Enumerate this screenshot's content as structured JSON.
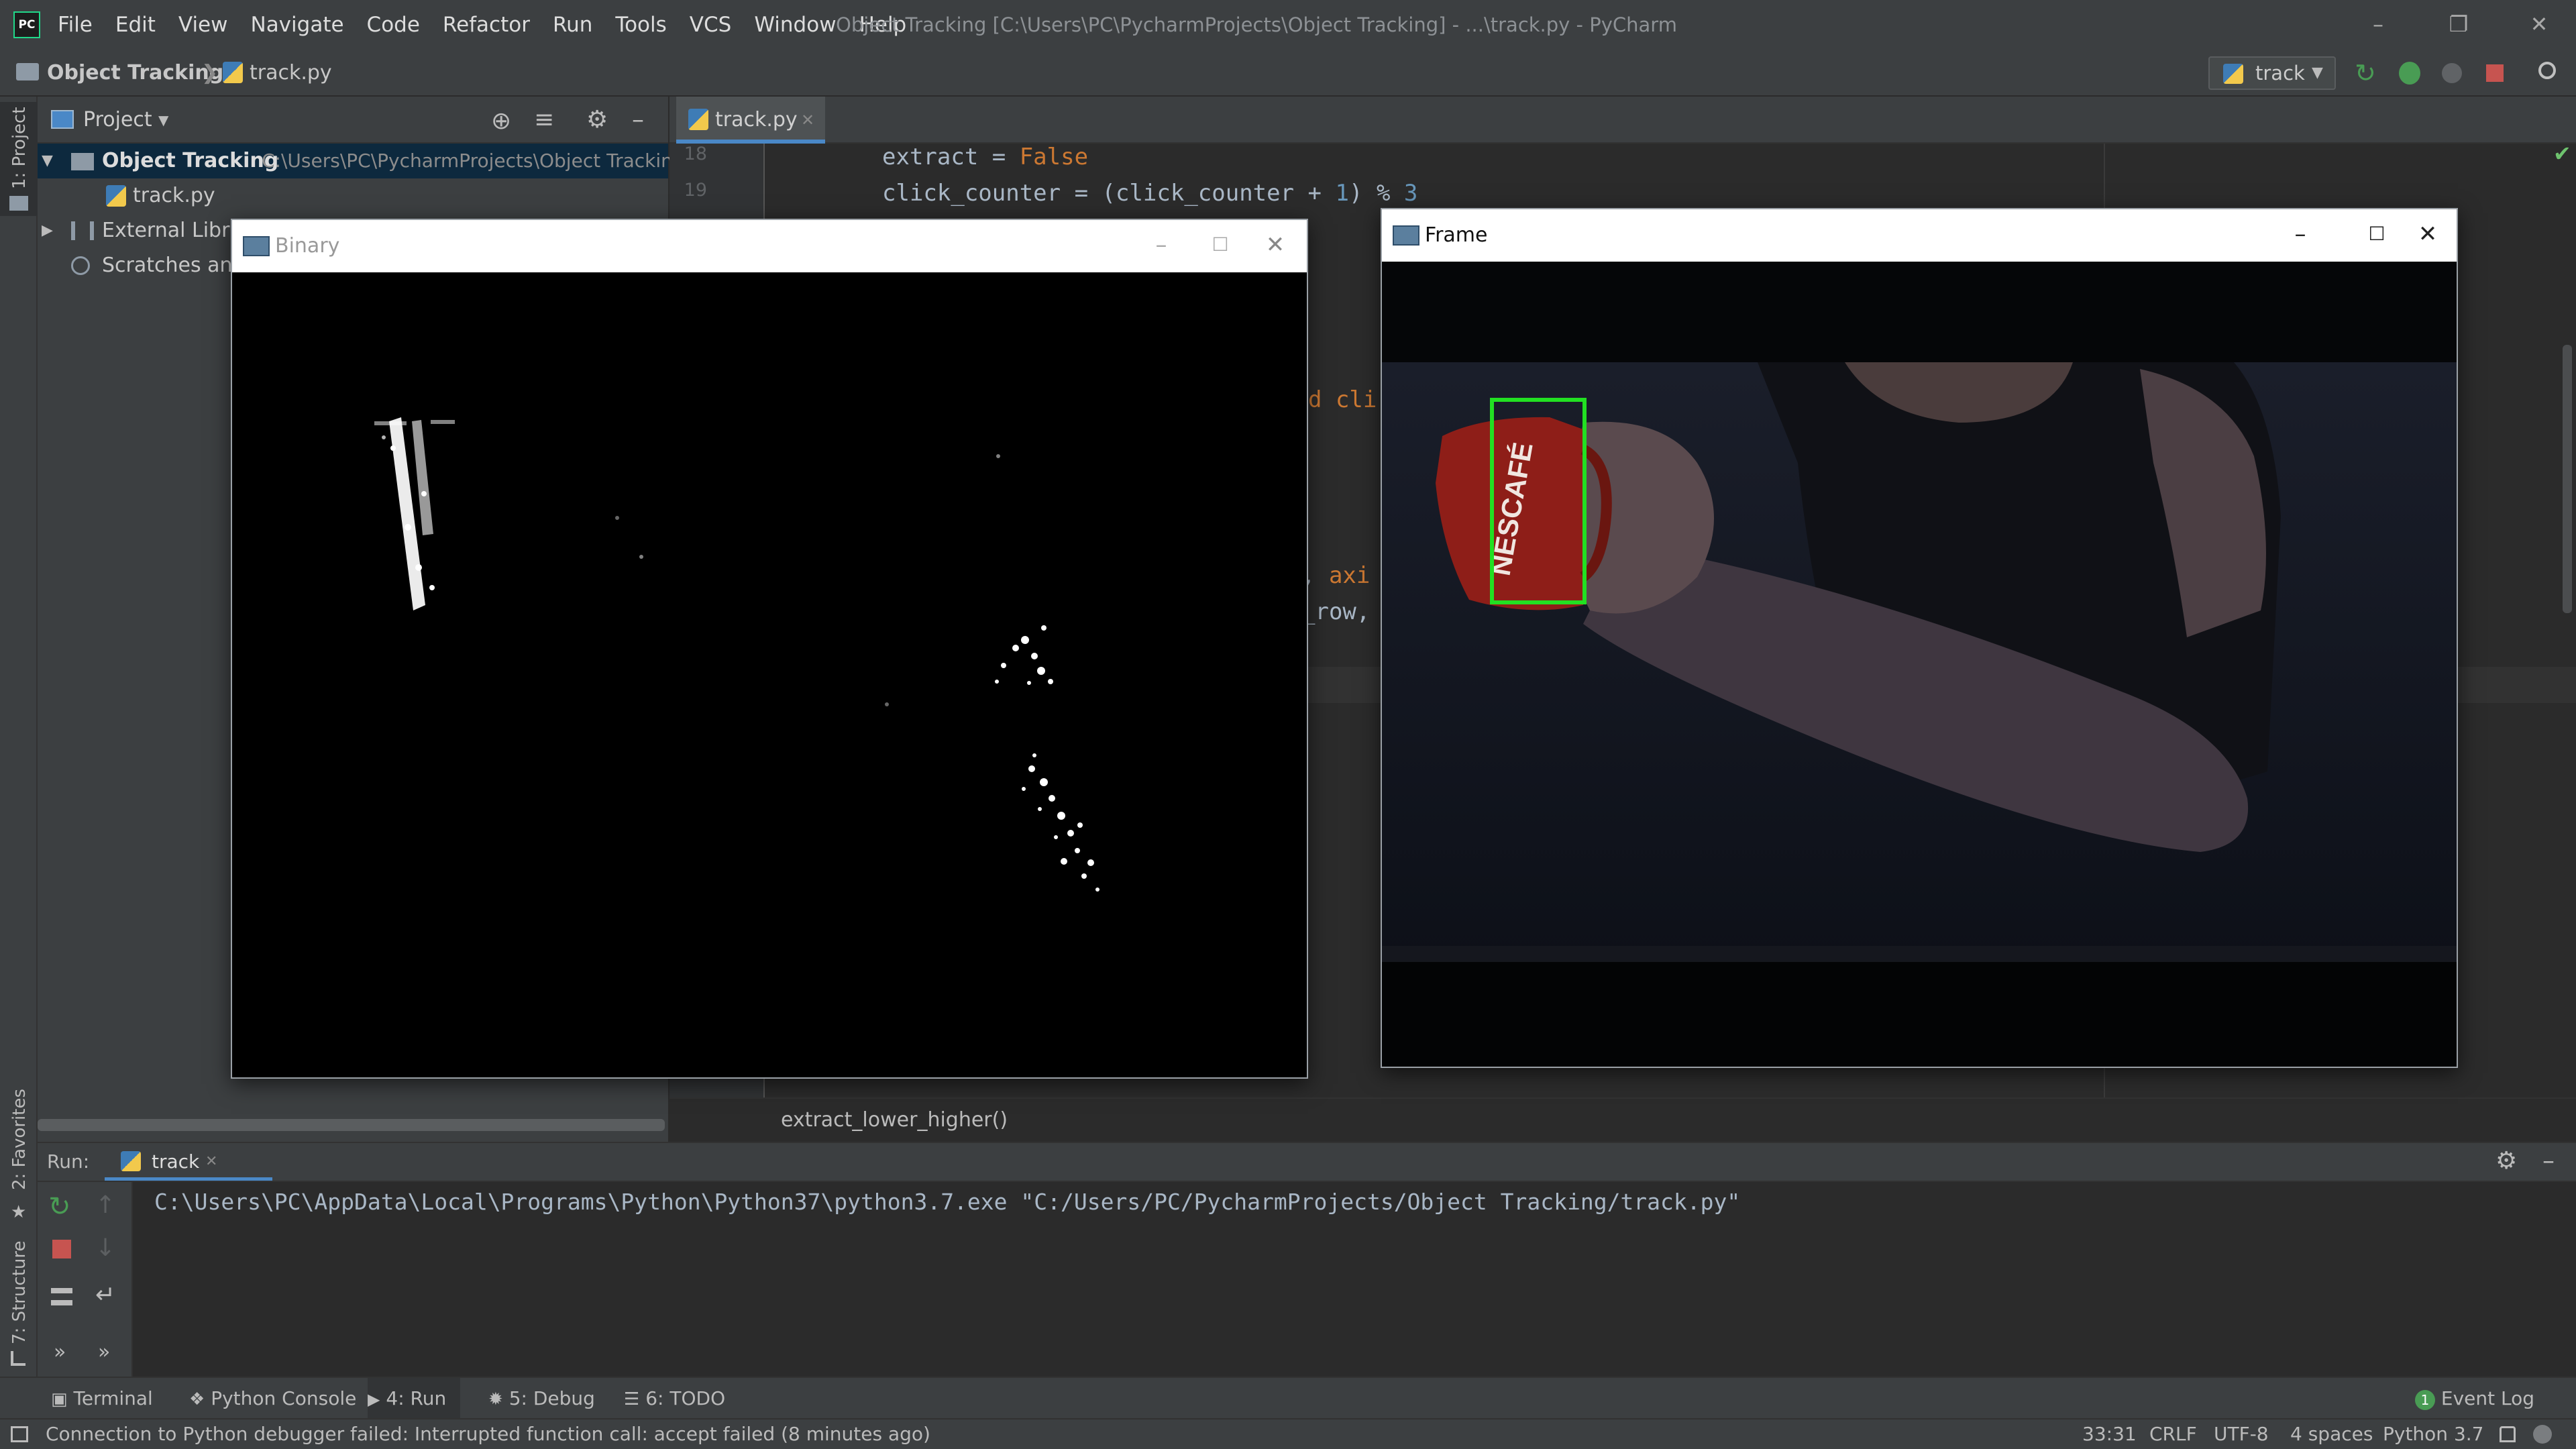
{
  "app": {
    "title": "Object Tracking [C:\\Users\\PC\\PycharmProjects\\Object Tracking] - ...\\track.py - PyCharm",
    "menu": [
      "File",
      "Edit",
      "View",
      "Navigate",
      "Code",
      "Refactor",
      "Run",
      "Tools",
      "VCS",
      "Window",
      "Help"
    ]
  },
  "navbar": {
    "project": "Object Tracking",
    "file": "track.py",
    "run_config": "track"
  },
  "sidestrip": {
    "project": "1: Project",
    "favorites": "2: Favorites",
    "structure": "7: Structure"
  },
  "project_panel": {
    "title": "Project",
    "root_name": "Object Tracking",
    "root_path": "C:\\Users\\PC\\PycharmProjects\\Object Tracking",
    "file": "track.py",
    "external": "External Librari",
    "scratches": "Scratches and"
  },
  "editor": {
    "tab": "track.py",
    "line18_no": "18",
    "line19_no": "19",
    "line18_a": "extract = ",
    "line18_b": "False",
    "line19_a": "click_counter = (click_counter + ",
    "line19_b": "1",
    "line19_c": ") % ",
    "line19_d": "3",
    "frag1": "d cli",
    "frag2a": ", ",
    "frag2b": "axi",
    "frag3": "_row,",
    "breadcrumb": "extract_lower_higher()"
  },
  "windows": {
    "binary_title": "Binary",
    "frame_title": "Frame",
    "frame_overlay_text": "NESCAFÉ"
  },
  "run": {
    "label": "Run:",
    "tab": "track",
    "command": "C:\\Users\\PC\\AppData\\Local\\Programs\\Python\\Python37\\python3.7.exe \"C:/Users/PC/PycharmProjects/Object Tracking/track.py\""
  },
  "bottom_tabs": {
    "terminal": "Terminal",
    "python_console": "Python Console",
    "run": "4: Run",
    "debug": "5: Debug",
    "todo": "6: TODO",
    "event_log_count": "1",
    "event_log": "Event Log"
  },
  "status": {
    "message": "Connection to Python debugger failed: Interrupted function call: accept failed (8 minutes ago)",
    "position": "33:31",
    "line_sep": "CRLF",
    "encoding": "UTF-8",
    "indent": "4 spaces",
    "interpreter": "Python 3.7"
  },
  "colors": {
    "accent": "#4a88c7",
    "run_green": "#499c54",
    "stop_red": "#c75450",
    "tracking_box": "#22e022"
  }
}
